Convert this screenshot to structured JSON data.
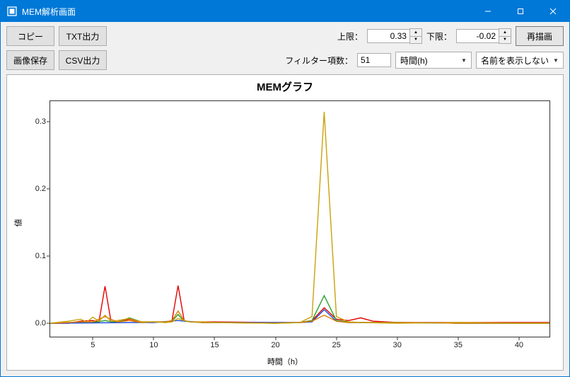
{
  "window": {
    "title": "MEM解析画面"
  },
  "toolbar": {
    "copy": "コピー",
    "txt_export": "TXT出力",
    "image_save": "画像保存",
    "csv_export": "CSV出力",
    "upper_label": "上限：",
    "upper_value": "0.33",
    "lower_label": "下限：",
    "lower_value": "-0.02",
    "redraw": "再描画",
    "filter_label": "フィルター項数：",
    "filter_value": "51",
    "xaxis_select": "時間(h)",
    "name_select": "名前を表示しない"
  },
  "chart_data": {
    "type": "line",
    "title": "MEMグラフ",
    "xlabel": "時間（h）",
    "ylabel": "値",
    "xlim": [
      1.5,
      42.5
    ],
    "ylim": [
      -0.02,
      0.33
    ],
    "xticks": [
      5,
      10,
      15,
      20,
      25,
      30,
      35,
      40
    ],
    "yticks": [
      0.0,
      0.1,
      0.2,
      0.3
    ],
    "colors": {
      "red": "#e60000",
      "green": "#2ca02c",
      "blue": "#1f4fd9",
      "gold": "#c9a20a",
      "orange": "#e07b00"
    },
    "series": [
      {
        "name": "red",
        "color": "red",
        "x": [
          1.5,
          2,
          3,
          4,
          5,
          5.5,
          6,
          6.5,
          7,
          8,
          9,
          10,
          11,
          11.5,
          12,
          12.5,
          13,
          14,
          15,
          20,
          22,
          23,
          24,
          25,
          26,
          27,
          28,
          30,
          35,
          40,
          42.5
        ],
        "y": [
          0,
          0,
          0,
          0.003,
          0.004,
          0.002,
          0.055,
          0.002,
          0.002,
          0.006,
          0.002,
          0.002,
          0.002,
          0.004,
          0.056,
          0.004,
          0.002,
          0.002,
          0.002,
          0.001,
          0.001,
          0.004,
          0.023,
          0.006,
          0.004,
          0.008,
          0.003,
          0.001,
          0.001,
          0.001,
          0.001
        ]
      },
      {
        "name": "green",
        "color": "green",
        "x": [
          1.5,
          4,
          5,
          6,
          7,
          8,
          9,
          10,
          11,
          11.5,
          12,
          12.5,
          13,
          14,
          15,
          20,
          22,
          23,
          24,
          25,
          26,
          27,
          30,
          35,
          40,
          42.5
        ],
        "y": [
          0,
          0.001,
          0.001,
          0.004,
          0.001,
          0.008,
          0.002,
          0.002,
          0.001,
          0.003,
          0.013,
          0.003,
          0.002,
          0.001,
          0.001,
          0,
          0.001,
          0.004,
          0.041,
          0.004,
          0.002,
          0.001,
          0.001,
          0,
          0,
          0
        ]
      },
      {
        "name": "blue",
        "color": "blue",
        "x": [
          1.5,
          8,
          10,
          12,
          14,
          20,
          22,
          23,
          24,
          25,
          26,
          30,
          35,
          40,
          42.5
        ],
        "y": [
          0,
          0.001,
          0.001,
          0.004,
          0.001,
          0.001,
          0.001,
          0.002,
          0.02,
          0.003,
          0.001,
          0.001,
          0,
          0,
          0
        ]
      },
      {
        "name": "orange",
        "color": "orange",
        "x": [
          1.5,
          4,
          5,
          6,
          7,
          8,
          9,
          10,
          11,
          11.5,
          12,
          12.5,
          13,
          14,
          15,
          20,
          22,
          23,
          24,
          25,
          26,
          30,
          35,
          40,
          42.5
        ],
        "y": [
          0,
          0.002,
          0.002,
          0.01,
          0.002,
          0.004,
          0.001,
          0.002,
          0.002,
          0.004,
          0.018,
          0.004,
          0.002,
          0.001,
          0.001,
          0,
          0.001,
          0.003,
          0.012,
          0.003,
          0.001,
          0.001,
          0,
          0,
          0
        ]
      },
      {
        "name": "gold",
        "color": "gold",
        "x": [
          1.5,
          3,
          4,
          4.5,
          5,
          5.5,
          6,
          6.5,
          7,
          8,
          9,
          10,
          11,
          11.5,
          12,
          12.5,
          13,
          14,
          15,
          20,
          22,
          23,
          24,
          25,
          26,
          27,
          30,
          35,
          40,
          42.5
        ],
        "y": [
          0,
          0.003,
          0.006,
          0.002,
          0.009,
          0.003,
          0.012,
          0.003,
          0.004,
          0.007,
          0.002,
          0.002,
          0.001,
          0.002,
          0.007,
          0.004,
          0.002,
          0.002,
          0.001,
          0,
          0.001,
          0.01,
          0.314,
          0.01,
          0.002,
          0.001,
          0,
          0.001,
          0,
          0
        ]
      }
    ]
  }
}
